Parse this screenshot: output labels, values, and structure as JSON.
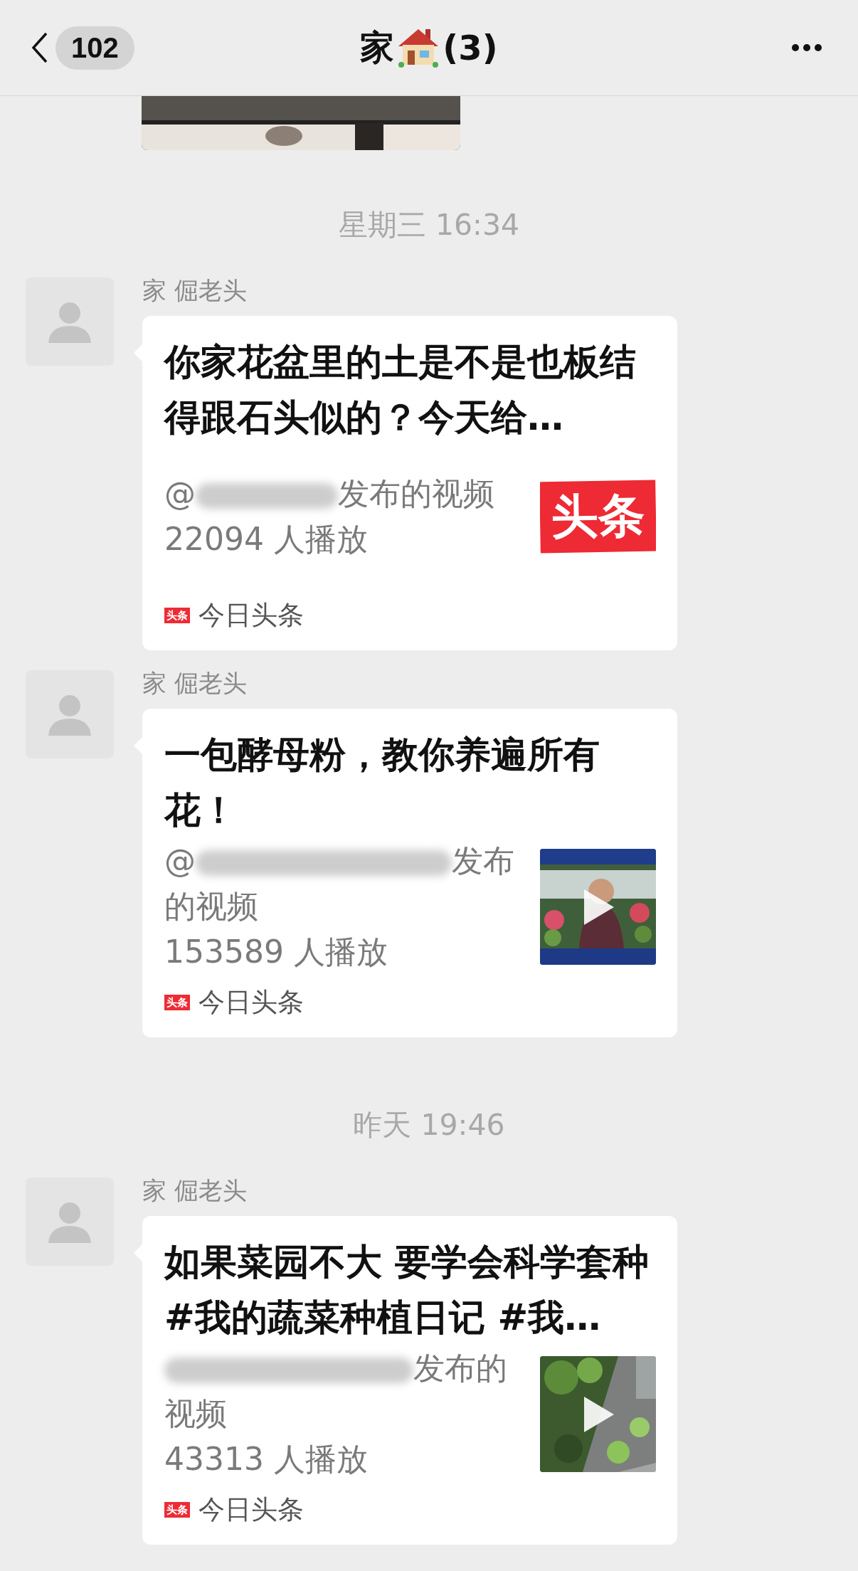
{
  "header": {
    "back_count": "102",
    "title": "家",
    "member_count": "(3)"
  },
  "messages": [
    {
      "kind": "time",
      "text": "星期三 16:34"
    },
    {
      "kind": "card",
      "sender": "家 倔老头",
      "title": "你家花盆里的土是不是也板结得跟石头似的？今天给…",
      "source_prefix": "@",
      "source": "发布的视频",
      "plays": "22094 人播放",
      "thumb": {
        "kind": "logo",
        "text": "头条"
      },
      "app_badge": "头条",
      "app": "今日头条"
    },
    {
      "kind": "card",
      "sender": "家 倔老头",
      "title": "一包酵母粉，教你养遍所有花！",
      "source_prefix": "@",
      "source": "发布",
      "source_tail": "的视频",
      "plays": "153589 人播放",
      "thumb": {
        "kind": "video"
      },
      "app_badge": "头条",
      "app": "今日头条"
    },
    {
      "kind": "time",
      "text": "昨天 19:46"
    },
    {
      "kind": "card",
      "sender": "家 倔老头",
      "title": "如果菜园不大 要学会科学套种 #我的蔬菜种植日记 #我…",
      "source": "发布的",
      "source_tail": "视频",
      "plays": "43313 人播放",
      "thumb": {
        "kind": "video"
      },
      "app_badge": "头条",
      "app": "今日头条"
    }
  ]
}
